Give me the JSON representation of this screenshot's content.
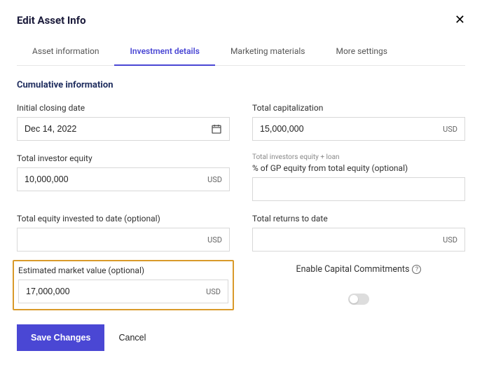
{
  "modal": {
    "title": "Edit Asset Info"
  },
  "tabs": [
    {
      "label": "Asset information"
    },
    {
      "label": "Investment details"
    },
    {
      "label": "Marketing materials"
    },
    {
      "label": "More settings"
    }
  ],
  "section": {
    "heading": "Cumulative information"
  },
  "fields": {
    "initial_closing_date": {
      "label": "Initial closing date",
      "value": "Dec 14, 2022"
    },
    "total_capitalization": {
      "label": "Total capitalization",
      "value": "15,000,000",
      "currency": "USD"
    },
    "total_investor_equity": {
      "label": "Total investor equity",
      "value": "10,000,000",
      "currency": "USD"
    },
    "gp_equity_pct": {
      "helper": "Total investors equity + loan",
      "label": "% of GP equity from total equity (optional)",
      "value": ""
    },
    "total_equity_invested": {
      "label": "Total equity invested to date (optional)",
      "value": "",
      "currency": "USD"
    },
    "total_returns": {
      "label": "Total returns to date",
      "value": "",
      "currency": "USD"
    },
    "estimated_market_value": {
      "label": "Estimated market value (optional)",
      "value": "17,000,000",
      "currency": "USD"
    },
    "enable_capital_commitments": {
      "label": "Enable Capital Commitments"
    }
  },
  "actions": {
    "save": "Save Changes",
    "cancel": "Cancel"
  }
}
